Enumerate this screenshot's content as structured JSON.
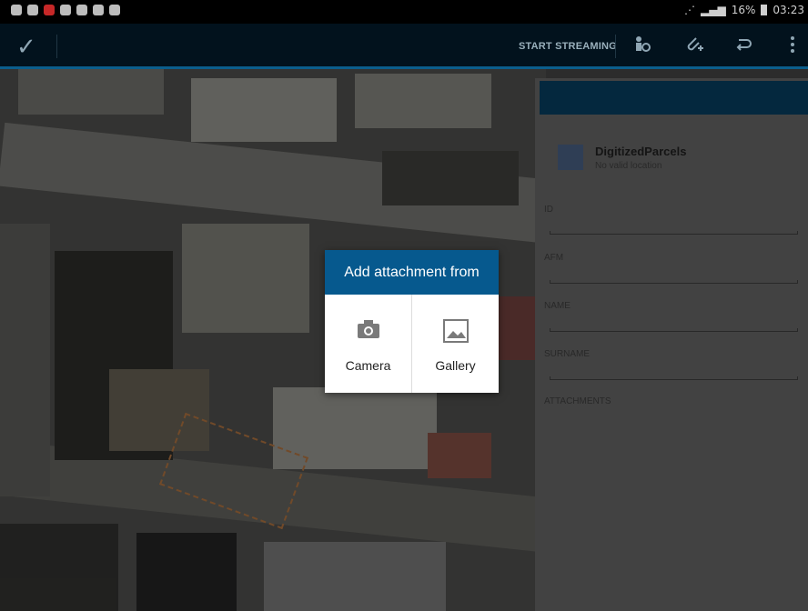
{
  "toolbar": {
    "start_streaming_label": "START STREAMING"
  },
  "status_bar": {
    "battery_text": "16%",
    "time": "03:23"
  },
  "feature_panel": {
    "layer_name": "DigitizedParcels",
    "location_status": "No valid location",
    "fields": [
      {
        "label": "ID"
      },
      {
        "label": "AFM"
      },
      {
        "label": "NAME"
      },
      {
        "label": "SURNAME"
      }
    ],
    "attachments_label": "ATTACHMENTS"
  },
  "dialog": {
    "title": "Add attachment from",
    "options": [
      {
        "label": "Camera",
        "icon": "camera-icon"
      },
      {
        "label": "Gallery",
        "icon": "image-icon"
      }
    ]
  }
}
